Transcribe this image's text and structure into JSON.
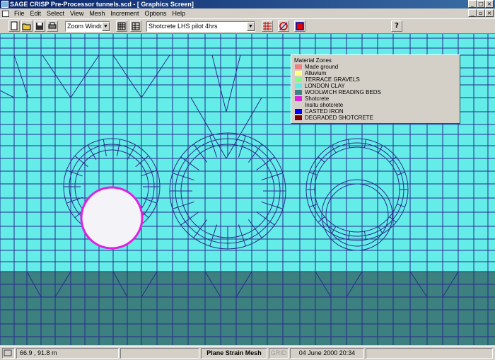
{
  "window": {
    "title": "SAGE CRISP Pre-Processor tunnels.scd - [ Graphics Screen]",
    "buttons": [
      "_",
      "□",
      "×"
    ],
    "mdi_buttons": [
      "_",
      "▫",
      "×"
    ]
  },
  "menu": [
    "File",
    "Edit",
    "Select",
    "View",
    "Mesh",
    "Increment",
    "Options",
    "Help"
  ],
  "toolbar": {
    "zoom_combo": "Zoom Window",
    "increment_combo": "Shotcrete LHS pilot 4hrs",
    "help_button": "?"
  },
  "legend": {
    "title": "Material Zones",
    "items": [
      {
        "label": "Made ground",
        "color": "#f08080"
      },
      {
        "label": "Alluvium",
        "color": "#ffff80"
      },
      {
        "label": "TERRACE GRAVELS",
        "color": "#80ff80"
      },
      {
        "label": "LONDON CLAY",
        "color": "#64ece8"
      },
      {
        "label": "WOOLWICH  READING BEDS",
        "color": "#3c8080"
      },
      {
        "label": "Shotcrete",
        "color": "#e020e0"
      },
      {
        "label": "Insitu shotcrete",
        "color": "#d4d0c8"
      },
      {
        "label": "CASTED IRON",
        "color": "#0000ff"
      },
      {
        "label": "DEGRADED SHOTCRETE",
        "color": "#800000"
      }
    ]
  },
  "status": {
    "coords": "66.9 , 91.8 m",
    "mode": "Plane Strain Mesh",
    "grid": "GRID",
    "datetime": "04 June 2000 20:34"
  },
  "colors": {
    "london_clay": "#64ece8",
    "woolwich": "#3c8080",
    "mesh_line": "#2a2a8c",
    "shotcrete": "#e020e0",
    "excavated": "#f4f4f8"
  }
}
